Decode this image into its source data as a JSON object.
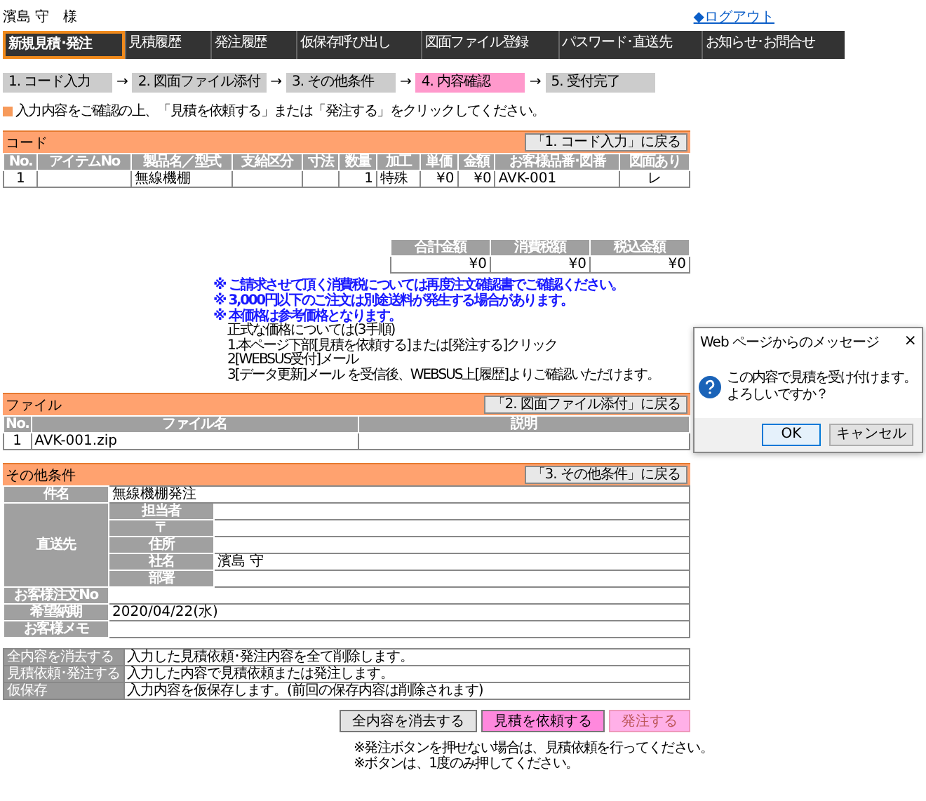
{
  "user": {
    "name": "濱島 守　様",
    "logout": "◆ログアウト"
  },
  "nav": [
    {
      "label": "新規見積･発注",
      "selected": true
    },
    {
      "label": "見積履歴",
      "selected": false
    },
    {
      "label": "発注履歴",
      "selected": false
    },
    {
      "label": "仮保存呼び出し",
      "selected": false
    },
    {
      "label": "図面ファイル登録",
      "selected": false
    },
    {
      "label": "パスワード･直送先",
      "selected": false
    },
    {
      "label": "お知らせ･お問合せ",
      "selected": false
    }
  ],
  "steps": [
    {
      "label": "1. コード入力",
      "selected": false
    },
    {
      "label": "2. 図面ファイル添付",
      "selected": false
    },
    {
      "label": "3. その他条件",
      "selected": false
    },
    {
      "label": "4. 内容確認",
      "selected": true
    },
    {
      "label": "5. 受付完了",
      "selected": false
    }
  ],
  "step_arrow": "→",
  "instruction": "入力内容をご確認の上、「見積を依頼する」または「発注する」をクリックしてください。",
  "code": {
    "title": "コード",
    "back": "「1. コード入力」に戻る",
    "columns": [
      "No.",
      "アイテムNo",
      "製品名／型式",
      "支給区分",
      "寸法",
      "数量",
      "加工",
      "単価",
      "金額",
      "お客様品番･図番",
      "図面あり"
    ],
    "rows": [
      [
        "1",
        "",
        "無線機棚",
        "",
        "",
        "1",
        "特殊",
        "¥0",
        "¥0",
        "AVK-001",
        "レ"
      ]
    ]
  },
  "totals": {
    "columns": [
      "合計金額",
      "消費税額",
      "税込金額"
    ],
    "values": [
      "¥0",
      "¥0",
      "¥0"
    ]
  },
  "notices": [
    "※ ご請求させて頂く消費税については再度注文確認書でご確認ください。",
    "※ 3,000円以下のご注文は別途送料が発生する場合があります。",
    "※ 本価格は参考価格となります。"
  ],
  "procedure": [
    "正式な価格については(3手順)",
    "1.本ページ下部[見積を依頼する]または[発注する]クリック",
    "2[WEBSUS受付]メール",
    "3[データ更新]メール を受信後、WEBSUS上[履歴]よりご確認いただけます。"
  ],
  "files": {
    "title": "ファイル",
    "back": "「2. 図面ファイル添付」に戻る",
    "columns": [
      "No.",
      "ファイル名",
      "説明"
    ],
    "rows": [
      [
        "1",
        "AVK-001.zip",
        ""
      ]
    ]
  },
  "conditions": {
    "title": "その他条件",
    "back": "「3. その他条件」に戻る",
    "subject": {
      "label": "件名",
      "value": "無線機棚発注"
    },
    "ship_to": {
      "label": "直送先",
      "fields": [
        {
          "label": "担当者"
        },
        {
          "label": "〒"
        },
        {
          "label": "住所"
        },
        {
          "label": "社名",
          "value": "濱島 守"
        },
        {
          "label": "部署"
        }
      ]
    },
    "rows": [
      {
        "label": "お客様注文No"
      },
      {
        "label": "希望納期",
        "value": "2020/04/22(水)"
      },
      {
        "label": "お客様メモ"
      }
    ]
  },
  "legend": [
    {
      "label": "全内容を消去する",
      "text": "入力した見積依頼･発注内容を全て削除します。"
    },
    {
      "label": "見積依頼･発注する",
      "text": "入力した内容で見積依頼または発注します。"
    },
    {
      "label": "仮保存",
      "text": "入力内容を仮保存します。(前回の保存内容は削除されます)"
    }
  ],
  "actions": [
    {
      "label": "全内容を消去する",
      "kind": "plain",
      "disabled": false
    },
    {
      "label": "見積を依頼する",
      "kind": "accent",
      "disabled": false
    },
    {
      "label": "発注する",
      "kind": "accent",
      "disabled": true
    }
  ],
  "footer_notes": [
    "※発注ボタンを押せない場合は、見積依頼を行ってください。",
    "※ボタンは、1度のみ押してください。"
  ],
  "dialog": {
    "title": "Web ページからのメッセージ",
    "close": "×",
    "message": [
      "この内容で見積を受け付けます。",
      "よろしいですか？"
    ],
    "buttons": [
      {
        "label": "OK",
        "selected": true
      },
      {
        "label": "キャンセル",
        "selected": false
      }
    ]
  }
}
